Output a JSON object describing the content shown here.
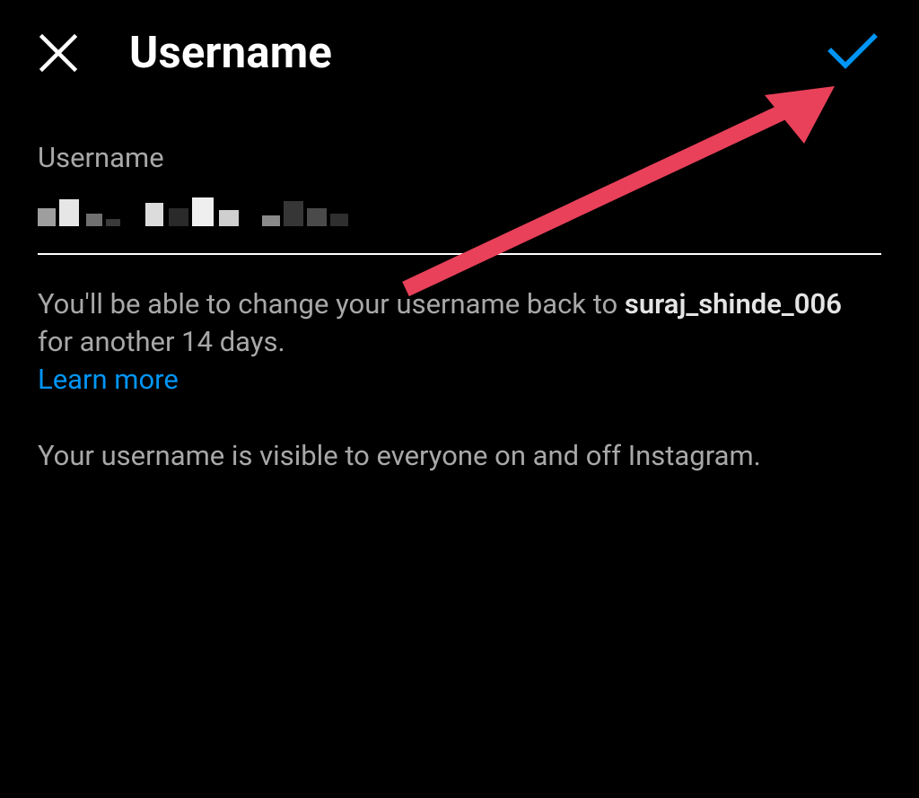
{
  "header": {
    "title": "Username"
  },
  "field": {
    "label": "Username",
    "value_redacted": true,
    "previous_username": "suraj_shinde_006"
  },
  "info": {
    "line1_prefix": "You'll be able to change your username back to ",
    "line1_suffix": " for another 14 days.",
    "learn_more": "Learn more"
  },
  "visibility": {
    "text": "Your username is visible to everyone on and off Instagram."
  },
  "icons": {
    "close": "close-icon",
    "confirm": "check-icon"
  },
  "annotation": {
    "type": "arrow",
    "target": "confirm-button"
  }
}
